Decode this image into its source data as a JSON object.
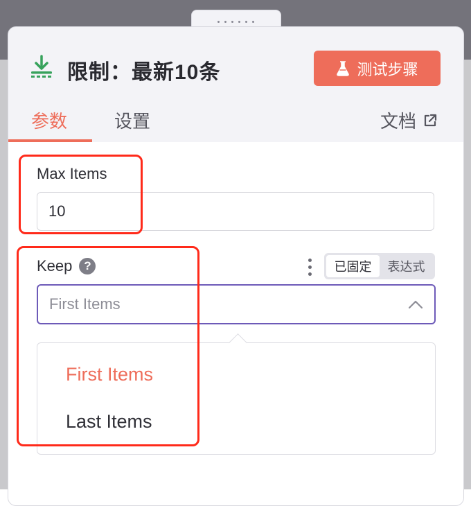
{
  "header": {
    "icon": "download-limit-icon",
    "title": "限制：最新10条",
    "test_button_label": "测试步骤",
    "test_button_icon": "flask-icon",
    "accent_color": "#ee6d5a"
  },
  "tabs": [
    {
      "label": "参数",
      "active": true
    },
    {
      "label": "设置",
      "active": false
    }
  ],
  "docs_link": {
    "label": "文档",
    "icon": "external-link-icon"
  },
  "fields": {
    "max_items": {
      "label": "Max Items",
      "value": "10"
    },
    "keep": {
      "label": "Keep",
      "help_icon": "?",
      "mode_options": [
        {
          "label": "已固定",
          "active": true
        },
        {
          "label": "表达式",
          "active": false
        }
      ],
      "selected": "First Items",
      "focus_color": "#6d5ab8",
      "options": [
        {
          "label": "First Items",
          "selected": true
        },
        {
          "label": "Last Items",
          "selected": false
        }
      ]
    }
  },
  "annotation_color": "#ff2a1a"
}
